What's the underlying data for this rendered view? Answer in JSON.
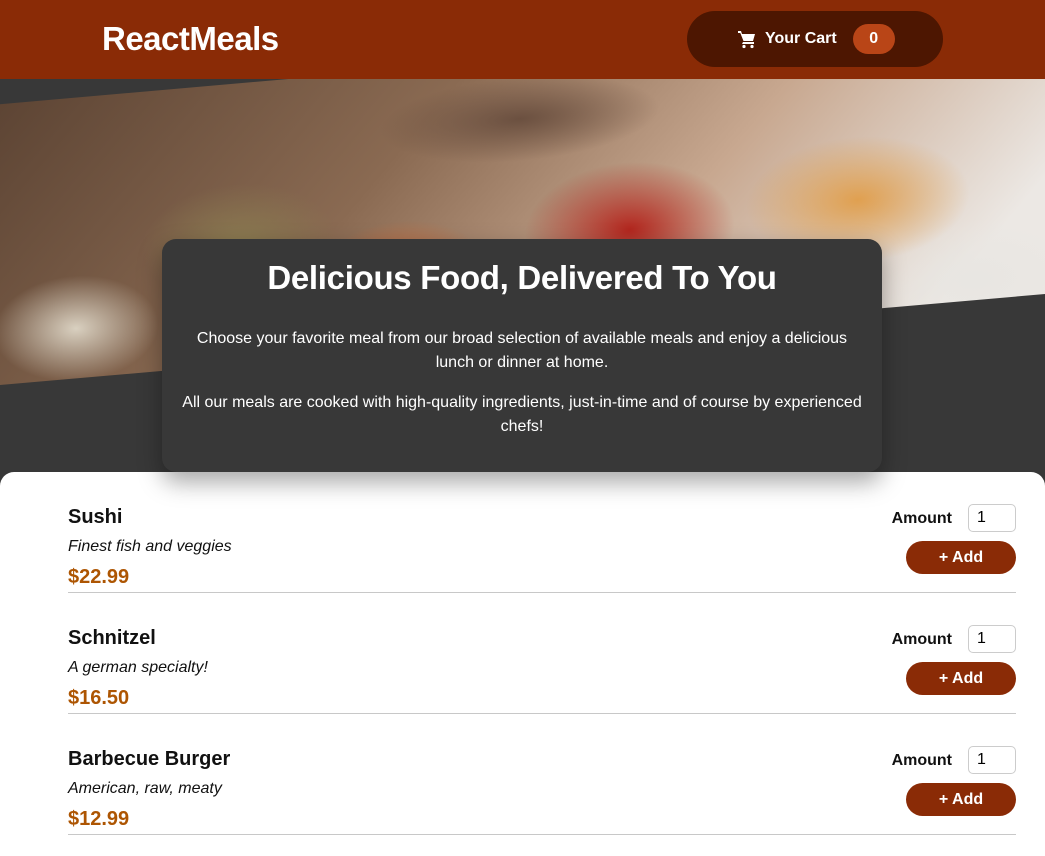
{
  "header": {
    "brand": "ReactMeals",
    "cart": {
      "label": "Your Cart",
      "count": "0",
      "icon": "cart-icon"
    }
  },
  "summary": {
    "title": "Delicious Food, Delivered To You",
    "paragraph1": "Choose your favorite meal from our broad selection of available meals and enjoy a delicious lunch or dinner at home.",
    "paragraph2": "All our meals are cooked with high-quality ingredients, just-in-time and of course by experienced chefs!"
  },
  "meals": [
    {
      "name": "Sushi",
      "description": "Finest fish and veggies",
      "price": "$22.99",
      "amount_label": "Amount",
      "amount": "1",
      "add_label": "+ Add"
    },
    {
      "name": "Schnitzel",
      "description": "A german specialty!",
      "price": "$16.50",
      "amount_label": "Amount",
      "amount": "1",
      "add_label": "+ Add"
    },
    {
      "name": "Barbecue Burger",
      "description": "American, raw, meaty",
      "price": "$12.99",
      "amount_label": "Amount",
      "amount": "1",
      "add_label": "+ Add"
    }
  ],
  "colors": {
    "header": "#8a2b06",
    "cart_button": "#4d1601",
    "badge": "#b94517",
    "price": "#ad5502",
    "background": "#383838"
  }
}
